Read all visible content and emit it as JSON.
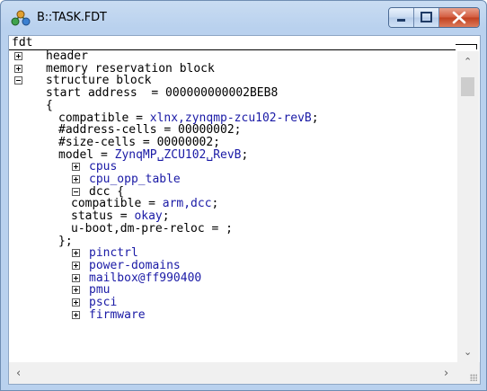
{
  "window": {
    "title": "B::TASK.FDT",
    "icon": "network-nodes-icon",
    "colors": {
      "frame": "#b9d1ee",
      "close": "#c94a2c",
      "blue_text": "#1a1aa6"
    }
  },
  "panel": {
    "header_label": "fdt"
  },
  "tree": [
    {
      "toggle": "plus",
      "text": "header"
    },
    {
      "toggle": "plus",
      "text": "memory reservation block"
    },
    {
      "toggle": "minus",
      "text": "structure block"
    },
    {
      "text": "start address  = 000000000002BEB8"
    },
    {
      "text": "{"
    },
    {
      "key": "compatible = ",
      "value": "xlnx,zynqmp-zcu102-revB",
      "tail": ";"
    },
    {
      "text": "#address-cells = 00000002;"
    },
    {
      "text": "#size-cells = 00000002;"
    },
    {
      "key": "model = ",
      "value": "ZynqMP␣ZCU102␣RevB",
      "tail": ";"
    },
    {
      "toggle": "plus",
      "text": "cpus"
    },
    {
      "toggle": "plus",
      "text": "cpu_opp_table"
    },
    {
      "toggle": "minus",
      "text": "dcc {"
    },
    {
      "key": "compatible = ",
      "value": "arm,dcc",
      "tail": ";"
    },
    {
      "key": "status = ",
      "value": "okay",
      "tail": ";"
    },
    {
      "text": "u-boot,dm-pre-reloc = ;"
    },
    {
      "text": "};"
    },
    {
      "toggle": "plus",
      "text": "pinctrl"
    },
    {
      "toggle": "plus",
      "text": "power-domains"
    },
    {
      "toggle": "plus",
      "text": "mailbox@ff990400"
    },
    {
      "toggle": "plus",
      "text": "pmu"
    },
    {
      "toggle": "plus",
      "text": "psci"
    },
    {
      "toggle": "plus",
      "text": "firmware"
    }
  ]
}
